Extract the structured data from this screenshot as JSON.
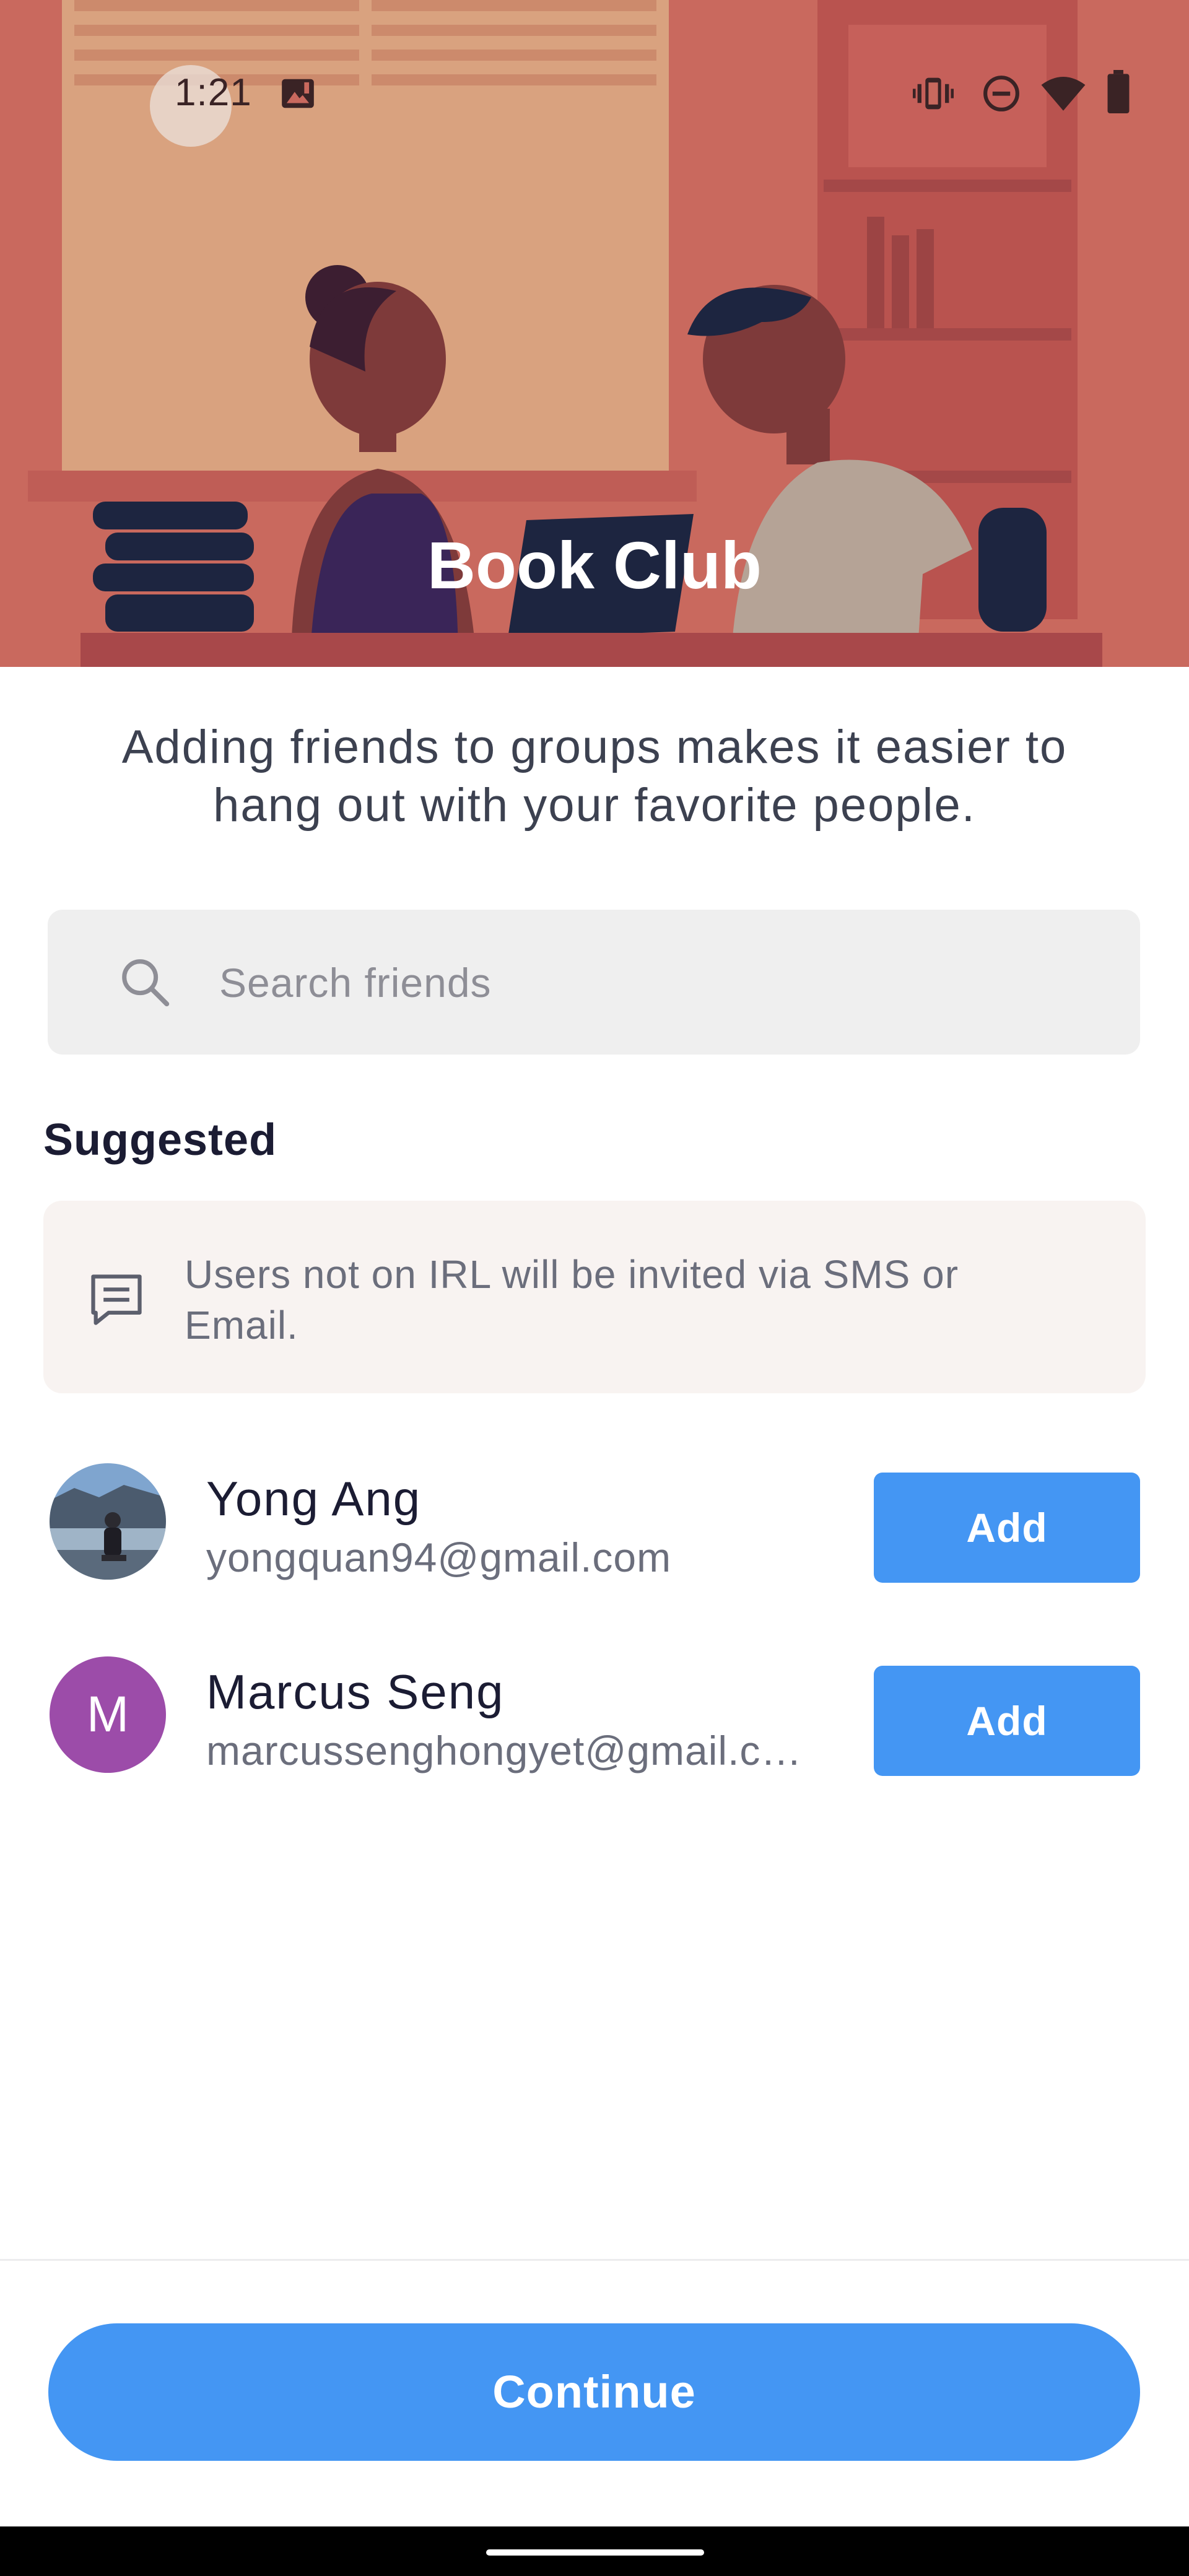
{
  "status_bar": {
    "time": "1:21",
    "icons": [
      "image-notification-icon",
      "vibrate-icon",
      "do-not-disturb-icon",
      "wifi-icon",
      "battery-icon"
    ]
  },
  "hero": {
    "title": "Book Club",
    "illustration": "two-people-reading-illustration",
    "background_color": "#c9695e"
  },
  "description": "Adding friends to groups makes it easier to hang out with your favorite people.",
  "search": {
    "placeholder": "Search friends",
    "value": "",
    "icon": "search-icon"
  },
  "suggested": {
    "heading": "Suggested",
    "info_note": {
      "icon": "message-icon",
      "text": "Users not on IRL will be invited via SMS or Email."
    },
    "contacts": [
      {
        "name": "Yong Ang",
        "email": "yongquan94@gmail.com",
        "avatar": "photo-avatar",
        "add_label": "Add"
      },
      {
        "name": "Marcus Seng",
        "email": "marcussenghongyet@gmail.c…",
        "avatar_letter": "M",
        "avatar_color": "#9c4ca9",
        "add_label": "Add"
      }
    ]
  },
  "footer": {
    "continue_label": "Continue"
  },
  "colors": {
    "accent": "#4496f3",
    "text_primary": "#1b1c33",
    "text_secondary": "#6b6e7c"
  }
}
